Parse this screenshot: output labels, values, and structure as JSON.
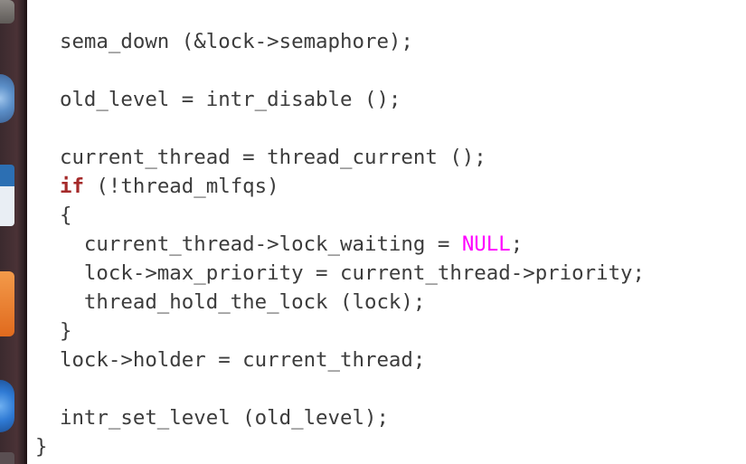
{
  "editor": {
    "lines": [
      "  sema_down (&lock->semaphore);",
      "",
      "  old_level = intr_disable ();",
      "",
      "  current_thread = thread_current ();",
      "",
      "  (!thread_mlfqs)",
      "  {",
      "    current_thread->lock_waiting = ",
      ";",
      "    lock->max_priority = current_thread->priority;",
      "    thread_hold_the_lock (lock);",
      "  }",
      "  lock->holder = current_thread;",
      "",
      "  intr_set_level (old_level);",
      "}"
    ],
    "keyword_if": "if",
    "constant_null": "NULL"
  },
  "colors": {
    "text": "#3c3c3c",
    "keyword": "#a52a2a",
    "constant": "#ff00ff",
    "background": "#ffffff"
  },
  "launcher": {
    "icons": [
      "app-icon",
      "browser-icon",
      "document-icon",
      "software-center-icon",
      "help-icon",
      "app-icon"
    ]
  }
}
